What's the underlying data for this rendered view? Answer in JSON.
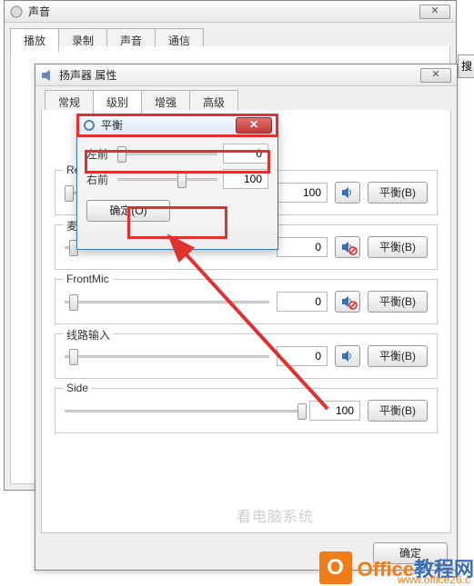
{
  "sound_window": {
    "title": "声音",
    "tabs": [
      "播放",
      "录制",
      "声音",
      "通信"
    ]
  },
  "prop_window": {
    "title": "扬声器 属性",
    "tabs": [
      "常规",
      "级别",
      "增强",
      "高级"
    ],
    "active_tab_index": 1,
    "groups": [
      {
        "name": "Re",
        "value": "100",
        "thumb_pct": 0,
        "muted": false
      },
      {
        "name": "麦克风",
        "value": "0",
        "thumb_pct": 2,
        "muted": true
      },
      {
        "name": "FrontMic",
        "value": "0",
        "thumb_pct": 2,
        "muted": true
      },
      {
        "name": "线路输入",
        "value": "0",
        "thumb_pct": 2,
        "muted": false
      },
      {
        "name": "Side",
        "value": "100",
        "thumb_pct": 98,
        "muted": false,
        "hide_aux": true
      }
    ],
    "balance_btn": "平衡(B)",
    "ok_btn": "确定"
  },
  "balance_dialog": {
    "title": "平衡",
    "rows": [
      {
        "label": "左前",
        "value": "0",
        "thumb_pct": 0
      },
      {
        "label": "右前",
        "value": "100",
        "thumb_pct": 60
      }
    ],
    "ok_btn": "确定(O)"
  },
  "search_stub": "搜",
  "watermark": {
    "brand_prefix": "Office",
    "brand_suffix": "教程网",
    "url_fragment": "www.office26.c",
    "faded": "看电脑系统"
  }
}
